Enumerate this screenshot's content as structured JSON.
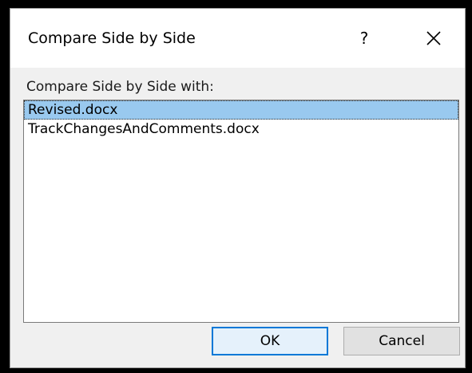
{
  "dialog": {
    "title": "Compare Side by Side",
    "help_label": "?",
    "close_icon": "close-icon",
    "prompt": "Compare Side by Side with:",
    "items": [
      {
        "label": "Revised.docx",
        "selected": true
      },
      {
        "label": "TrackChangesAndComments.docx",
        "selected": false
      }
    ],
    "ok_label": "OK",
    "cancel_label": "Cancel"
  },
  "colors": {
    "selection": "#99c9ef",
    "default_button_border": "#0078d7",
    "titlebar": "#ffffff",
    "body": "#f0f0f0"
  }
}
